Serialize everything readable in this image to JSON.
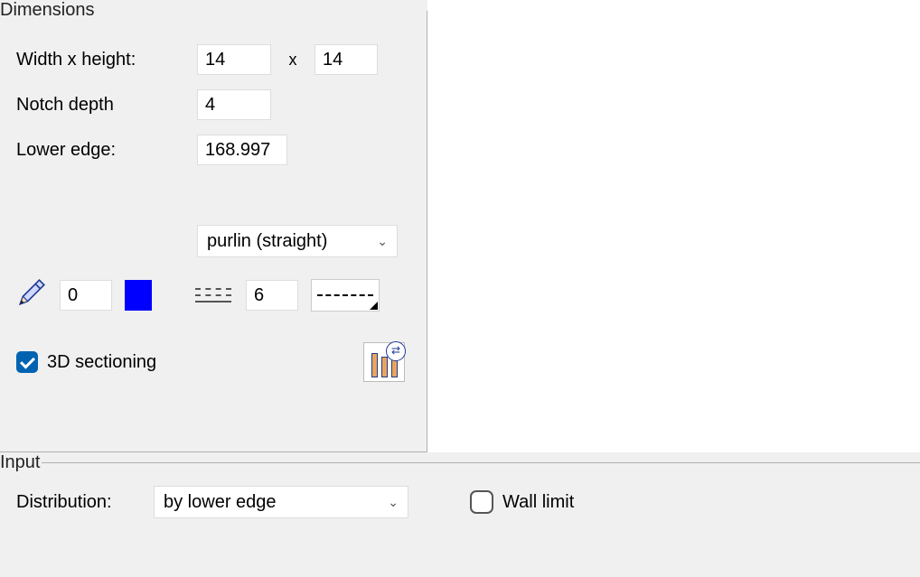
{
  "dimensions": {
    "legend": "Dimensions",
    "width_height_label": "Width x height:",
    "width_value": "14",
    "x_separator": "x",
    "height_value": "14",
    "notch_depth_label": "Notch depth",
    "notch_depth_value": "4",
    "lower_edge_label": "Lower edge:",
    "lower_edge_value": "168.997",
    "type_select": {
      "selected": "purlin (straight)"
    },
    "pen_number": "0",
    "pen_color": "#0000ff",
    "line_number": "6",
    "sectioning_label": "3D sectioning",
    "sectioning_checked": true
  },
  "input": {
    "legend": "Input",
    "distribution_label": "Distribution:",
    "distribution_select": {
      "selected": "by lower edge"
    },
    "wall_limit_label": "Wall limit",
    "wall_limit_checked": false
  }
}
